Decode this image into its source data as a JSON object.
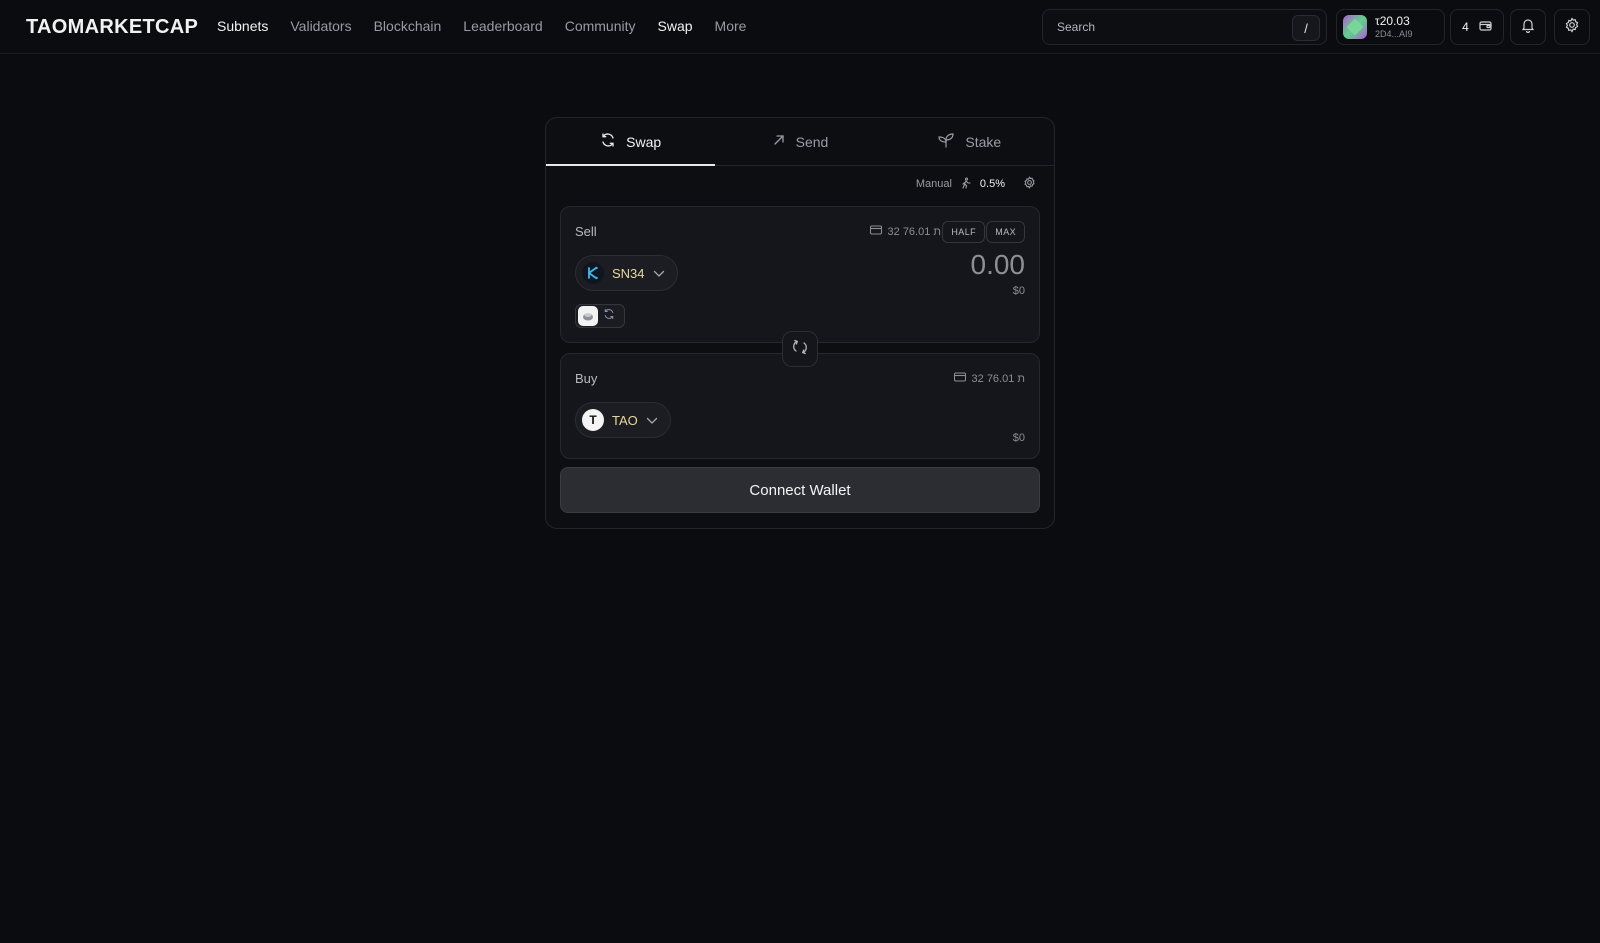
{
  "header": {
    "logo": "TAOMARKETCAP",
    "nav": [
      {
        "label": "Subnets",
        "active": true
      },
      {
        "label": "Validators",
        "active": false
      },
      {
        "label": "Blockchain",
        "active": false
      },
      {
        "label": "Leaderboard",
        "active": false
      },
      {
        "label": "Community",
        "active": false
      },
      {
        "label": "Swap",
        "active": true
      },
      {
        "label": "More",
        "active": false
      }
    ],
    "search": {
      "placeholder": "Search",
      "shortcut": "/"
    },
    "account": {
      "balance": "τ20.03",
      "address": "2D4...AI9"
    },
    "wallet_count": "4"
  },
  "swap": {
    "tabs": [
      {
        "label": "Swap",
        "icon": "refresh-icon",
        "active": true
      },
      {
        "label": "Send",
        "icon": "arrow-up-right-icon",
        "active": false
      },
      {
        "label": "Stake",
        "icon": "sprout-icon",
        "active": false
      }
    ],
    "slippage": {
      "mode": "Manual",
      "value": "0.5%"
    },
    "sell": {
      "label": "Sell",
      "balance": "ת 76.01 32",
      "half_label": "HALF",
      "max_label": "MAX",
      "token": "SN34",
      "amount": "0.00",
      "usd": "$0"
    },
    "buy": {
      "label": "Buy",
      "balance": "ת 76.01 32",
      "token": "TAO",
      "token_glyph": "T",
      "usd": "$0"
    },
    "connect_label": "Connect Wallet"
  },
  "colors": {
    "background": "#0b0c10",
    "panel": "#15161b",
    "token_text": "#e9d7a0",
    "button": "#2c2d33"
  }
}
